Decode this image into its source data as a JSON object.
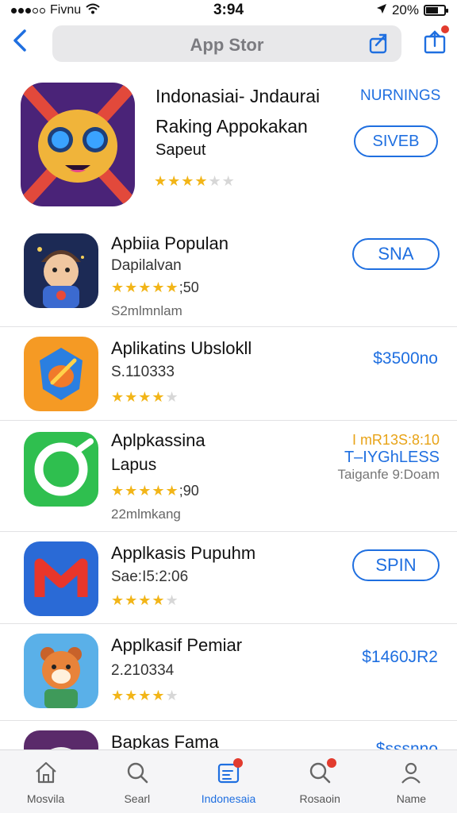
{
  "status_bar": {
    "carrier": "Fivnu",
    "time": "3:94",
    "battery": "20%"
  },
  "nav": {
    "search_text": "App Stor"
  },
  "featured": {
    "title": "Indonasiai- Jndaurai",
    "subtitle": "Raking Appokakan",
    "subtitle2": "Sapeut",
    "tag": "NURNINGS",
    "button": "SIVEB",
    "rating": 3.5
  },
  "apps": [
    {
      "name": "Apbiia Populan",
      "line1": "Dapilalvan",
      "rating_text": ";50",
      "line3": "S2mlmnlam",
      "button": "SNA"
    },
    {
      "name": "Aplikatins Ubslokll",
      "line1": "S.110333",
      "price": "$3500no"
    },
    {
      "name": "Aplpkassina",
      "line1": "Lapus",
      "rating_text": ";90",
      "line3": "22mlmkang",
      "rank1": "I mR13S:8:10",
      "rank2": "T–IYGhLESS",
      "rank3": "Taiganfe 9:Doam"
    },
    {
      "name": "Applkasis Pupuhm",
      "line1": "Sae:I5:2:06",
      "button": "SPIN"
    },
    {
      "name": "Applkasif Pemiar",
      "line1": "2.210334",
      "price": "$1460JR2"
    },
    {
      "name": "Bapkas Fama",
      "price": "$sssnno"
    }
  ],
  "tabs": [
    {
      "label": "Mosvila",
      "icon": "home-icon"
    },
    {
      "label": "Searl",
      "icon": "search-icon"
    },
    {
      "label": "Indonesaia",
      "icon": "today-icon"
    },
    {
      "label": "Rosaoin",
      "icon": "search-badge-icon"
    },
    {
      "label": "Name",
      "icon": "person-icon"
    }
  ],
  "colors": {
    "accent": "#1f6fe0",
    "star": "#f2b518",
    "badge": "#e23b2e"
  }
}
